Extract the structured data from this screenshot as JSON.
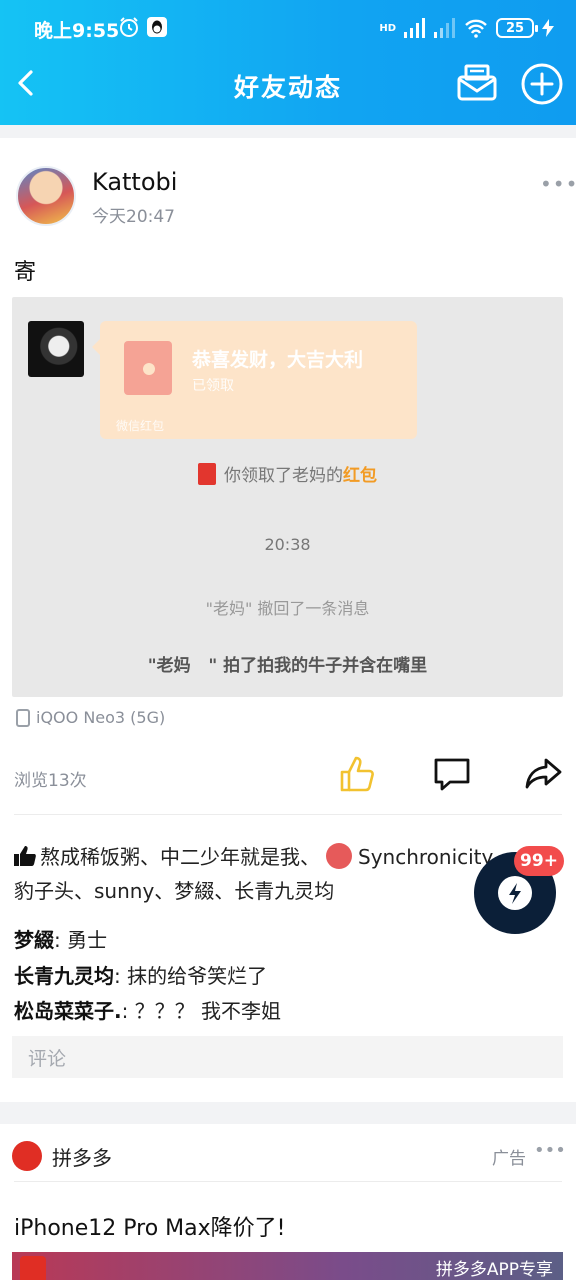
{
  "status_bar": {
    "time": "晚上9:55",
    "network_tag": "HD",
    "battery": "25"
  },
  "nav": {
    "title": "好友动态"
  },
  "post": {
    "author": "Kattobi",
    "time": "今天20:47",
    "more": "•••",
    "text": "寄",
    "screenshot": {
      "redpacket_title": "恭喜发财，大吉大利",
      "redpacket_status": "已领取",
      "redpacket_footer": "微信红包",
      "received_text_prefix": "你领取了老妈的",
      "received_text_highlight": "红包",
      "timestamp": "20:38",
      "recall_text": "\"老妈\" 撤回了一条消息",
      "pat_text": "\"老妈   \" 拍了拍我的牛子并含在嘴里"
    },
    "device": "iQOO Neo3 (5G)",
    "views": "浏览13次",
    "likes_part1": "熬成稀饭粥、中二少年就是我、",
    "likes_part2": "Synchronicity",
    "likes_part3": "豹子头、sunny、梦綴、长青九灵均",
    "comments": [
      {
        "author": "梦綴",
        "text": ": 勇士"
      },
      {
        "author": "长青九灵均",
        "text": ": 抹的给爷笑烂了"
      },
      {
        "author": "松岛菜菜子.",
        "text": ": ？？？ 我不李姐"
      }
    ],
    "comment_placeholder": "评论"
  },
  "fab": {
    "badge": "99+"
  },
  "ad": {
    "brand": "拼多多",
    "tag": "广告",
    "more": "•••",
    "title": "iPhone12 Pro Max降价了!",
    "banner_label": "拼多多APP专享"
  },
  "colors": {
    "topbar": "#11a4f2",
    "like_icon": "#f2c230",
    "highlight": "#f29b25",
    "badge": "#f24c4c"
  }
}
